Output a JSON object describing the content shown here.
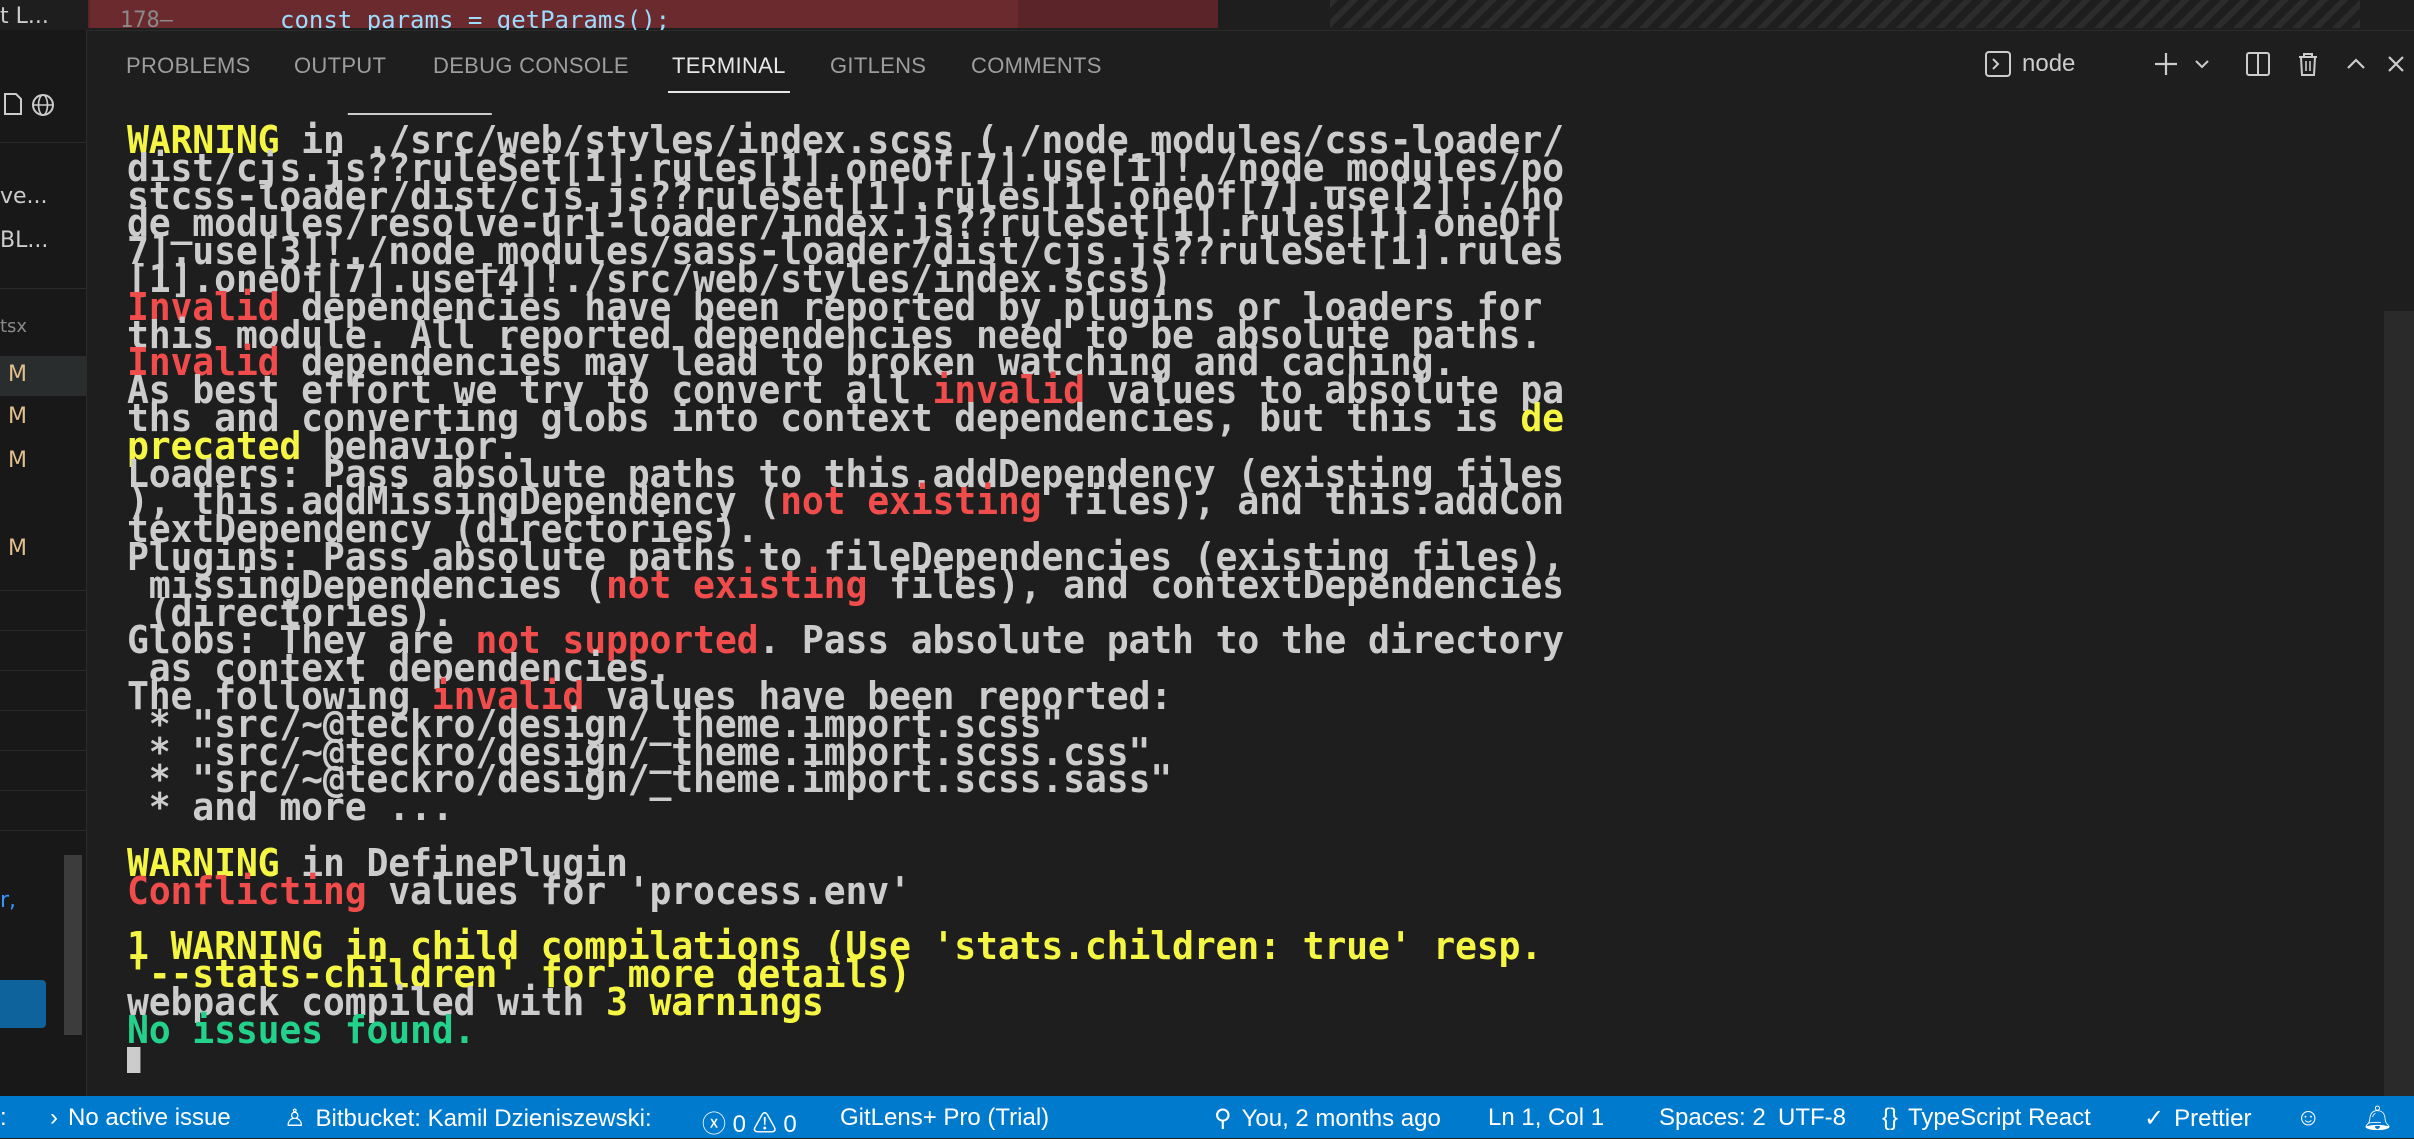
{
  "editor": {
    "line_number": "178—",
    "code_text": "const params = getParams();",
    "corner_text": "t L..."
  },
  "sidebar": {
    "items": [
      {
        "label": "ve..."
      },
      {
        "label": "BL..."
      },
      {
        "label": "tsx"
      },
      {
        "label": "M"
      },
      {
        "label": "M"
      },
      {
        "label": "M"
      },
      {
        "label": "M"
      }
    ],
    "link_text": "r,"
  },
  "panel": {
    "tabs": [
      {
        "label": "PROBLEMS"
      },
      {
        "label": "OUTPUT"
      },
      {
        "label": "DEBUG CONSOLE"
      },
      {
        "label": "TERMINAL",
        "active": true
      },
      {
        "label": "GITLENS"
      },
      {
        "label": "COMMENTS"
      }
    ],
    "terminal_name": "node"
  },
  "terminal": {
    "lines": [
      [
        {
          "t": "WARNING",
          "c": "y"
        },
        {
          "t": " in ./src/web/styles/index.scss (./node_modules/css-loader/",
          "c": "c"
        }
      ],
      [
        {
          "t": "dist/cjs.js??ruleSet[1].rules[1].oneOf[7].use[1]!./node_modules/po",
          "c": "c"
        }
      ],
      [
        {
          "t": "stcss-loader/dist/cjs.js??ruleSet[1].rules[1].oneOf[7].use[2]!./no",
          "c": "c"
        }
      ],
      [
        {
          "t": "de_modules/resolve-url-loader/index.js??ruleSet[1].rules[1].oneOf[",
          "c": "c"
        }
      ],
      [
        {
          "t": "7].use[3]!./node_modules/sass-loader/dist/cjs.js??ruleSet[1].rules",
          "c": "c"
        }
      ],
      [
        {
          "t": "[1].oneOf[7].use[4]!./src/web/styles/index.scss)",
          "c": "c"
        }
      ],
      [
        {
          "t": "Invalid",
          "c": "r"
        },
        {
          "t": " dependencies have been reported by plugins or loaders for",
          "c": "c"
        }
      ],
      [
        {
          "t": "this module. All reported dependencies need to be absolute paths.",
          "c": "c"
        }
      ],
      [
        {
          "t": "Invalid",
          "c": "r"
        },
        {
          "t": " dependencies may lead to broken watching and caching.",
          "c": "c"
        }
      ],
      [
        {
          "t": "As best effort we try to convert all ",
          "c": "c"
        },
        {
          "t": "invalid",
          "c": "r"
        },
        {
          "t": " values to absolute pa",
          "c": "c"
        }
      ],
      [
        {
          "t": "ths and converting globs into context dependencies, but this is ",
          "c": "c"
        },
        {
          "t": "de",
          "c": "y"
        }
      ],
      [
        {
          "t": "precated",
          "c": "y"
        },
        {
          "t": " behavior.",
          "c": "c"
        }
      ],
      [
        {
          "t": "Loaders: Pass absolute paths to this.addDependency (existing files",
          "c": "c"
        }
      ],
      [
        {
          "t": "), this.addMissingDependency (",
          "c": "c"
        },
        {
          "t": "not existing",
          "c": "r"
        },
        {
          "t": " files), and this.addCon",
          "c": "c"
        }
      ],
      [
        {
          "t": "textDependency (directories).",
          "c": "c"
        }
      ],
      [
        {
          "t": "Plugins: Pass absolute paths to fileDependencies (existing files),",
          "c": "c"
        }
      ],
      [
        {
          "t": " missingDependencies (",
          "c": "c"
        },
        {
          "t": "not existing",
          "c": "r"
        },
        {
          "t": " files), and contextDependencies",
          "c": "c"
        }
      ],
      [
        {
          "t": " (directories).",
          "c": "c"
        }
      ],
      [
        {
          "t": "Globs: They are ",
          "c": "c"
        },
        {
          "t": "not supported",
          "c": "r"
        },
        {
          "t": ". Pass absolute path to the directory",
          "c": "c"
        }
      ],
      [
        {
          "t": " as context dependencies.",
          "c": "c"
        }
      ],
      [
        {
          "t": "The following ",
          "c": "c"
        },
        {
          "t": "invalid",
          "c": "r"
        },
        {
          "t": " values have been reported:",
          "c": "c"
        }
      ],
      [
        {
          "t": " * \"src/~@teckro/design/_theme.import.scss\"",
          "c": "c"
        }
      ],
      [
        {
          "t": " * \"src/~@teckro/design/_theme.import.scss.css\"",
          "c": "c"
        }
      ],
      [
        {
          "t": " * \"src/~@teckro/design/_theme.import.scss.sass\"",
          "c": "c"
        }
      ],
      [
        {
          "t": " * and more ...",
          "c": "c"
        }
      ],
      [
        {
          "t": "",
          "c": "c"
        }
      ],
      [
        {
          "t": "WARNING",
          "c": "y"
        },
        {
          "t": " in DefinePlugin",
          "c": "c"
        }
      ],
      [
        {
          "t": "Conflicting",
          "c": "r"
        },
        {
          "t": " values for 'process.env'",
          "c": "c"
        }
      ],
      [
        {
          "t": "",
          "c": "c"
        }
      ],
      [
        {
          "t": "1 WARNING in child compilations (Use 'stats.children: true' resp.",
          "c": "y"
        }
      ],
      [
        {
          "t": "'--stats-children' for more details)",
          "c": "y"
        }
      ],
      [
        {
          "t": "webpack compiled with ",
          "c": "c"
        },
        {
          "t": "3 warnings",
          "c": "y"
        }
      ],
      [
        {
          "t": "No issues found.",
          "c": "g"
        }
      ]
    ]
  },
  "statusbar": {
    "left_fragment": ":",
    "active_issue": "No active issue",
    "bitbucket": "Bitbucket: Kamil Dzieniszewski:",
    "errors": "0",
    "warnings": "0",
    "gitlens": "GitLens+ Pro (Trial)",
    "blame": "You, 2 months ago",
    "position": "Ln 1, Col 1",
    "spaces": "Spaces: 2",
    "encoding": "UTF-8",
    "language": "TypeScript React",
    "formatter": "Prettier"
  },
  "colors": {
    "status_bar": "#007acc",
    "warning_yellow": "#f5f543",
    "error_red": "#f14c4c",
    "success_green": "#23d18b"
  }
}
